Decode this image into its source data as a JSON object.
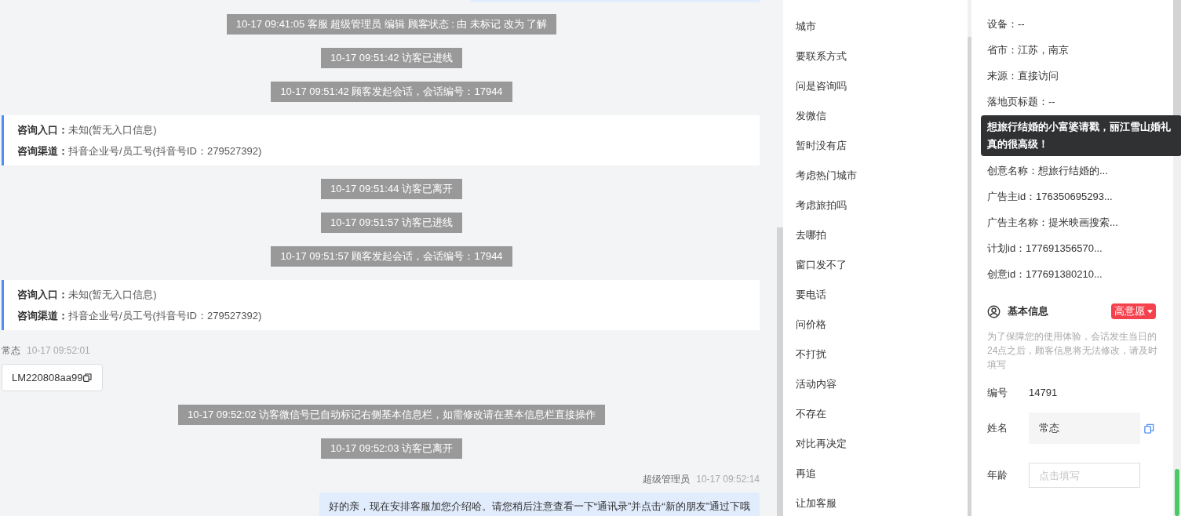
{
  "chat": {
    "messages": [
      {
        "kind": "system",
        "text": "10-17 09:41:05 客服 超级管理员 编辑 顾客状态 : 由 未标记 改为 了解"
      },
      {
        "kind": "system",
        "text": "10-17 09:51:42 访客已进线"
      },
      {
        "kind": "system",
        "text": "10-17 09:51:42 顾客发起会话，会话编号：17944"
      },
      {
        "kind": "entry_info",
        "lines": [
          {
            "label": "咨询入口：",
            "value": "未知(暂无入口信息)"
          },
          {
            "label": "咨询渠道：",
            "value": "抖音企业号/员工号(抖音号ID：279527392)"
          }
        ]
      },
      {
        "kind": "system",
        "text": "10-17 09:51:44 访客已离开"
      },
      {
        "kind": "system",
        "text": "10-17 09:51:57 访客已进线"
      },
      {
        "kind": "system",
        "text": "10-17 09:51:57 顾客发起会话，会话编号：17944"
      },
      {
        "kind": "entry_info",
        "lines": [
          {
            "label": "咨询入口：",
            "value": "未知(暂无入口信息)"
          },
          {
            "label": "咨询渠道：",
            "value": "抖音企业号/员工号(抖音号ID：279527392)"
          }
        ]
      },
      {
        "kind": "customer_message",
        "sender": "常态",
        "time": "10-17 09:52:01",
        "text": "LM220808aa99"
      },
      {
        "kind": "system",
        "text": "10-17 09:52:02 访客微信号已自动标记右侧基本信息栏，如需修改请在基本信息栏直接操作"
      },
      {
        "kind": "system",
        "text": "10-17 09:52:03 访客已离开"
      },
      {
        "kind": "agent_message",
        "sender": "超级管理员",
        "time": "10-17 09:52:14",
        "text": "好的亲，现在安排客服加您介绍哈。请您稍后注意查看一下“通讯录”并点击“新的朋友”通过下哦"
      }
    ]
  },
  "quick_tags": [
    "城市",
    "要联系方式",
    "问是咨询吗",
    "发微信",
    "暂时没有店",
    "考虑热门城市",
    "考虑旅拍吗",
    "去哪拍",
    "窗口发不了",
    "要电话",
    "问价格",
    "不打扰",
    "活动内容",
    "不存在",
    "对比再决定",
    "再追",
    "让加客服"
  ],
  "visitor_info": {
    "rows_top": [
      "设备：--",
      "省市：江苏，南京",
      "来源：直接访问",
      "落地页标题：--"
    ],
    "tooltip": "想旅行结婚的小富婆请戳，丽江雪山婚礼真的很高级！",
    "rows_bottom": [
      "创意名称：想旅行结婚的...",
      "广告主id：176350695293...",
      "广告主名称：提米映画搜索...",
      "计划id：177691356570...",
      "创意id：177691380210..."
    ]
  },
  "basic_info": {
    "title": "基本信息",
    "intent": "高意愿",
    "note": "为了保障您的使用体验，会话发生当日的24点之后，顾客信息将无法修改，请及时填写",
    "fields": [
      {
        "kind": "text",
        "label": "编号",
        "value": "14791"
      },
      {
        "kind": "filled",
        "label": "姓名",
        "value": "常态"
      },
      {
        "kind": "input",
        "label": "年龄",
        "placeholder": "点击填写"
      }
    ]
  }
}
